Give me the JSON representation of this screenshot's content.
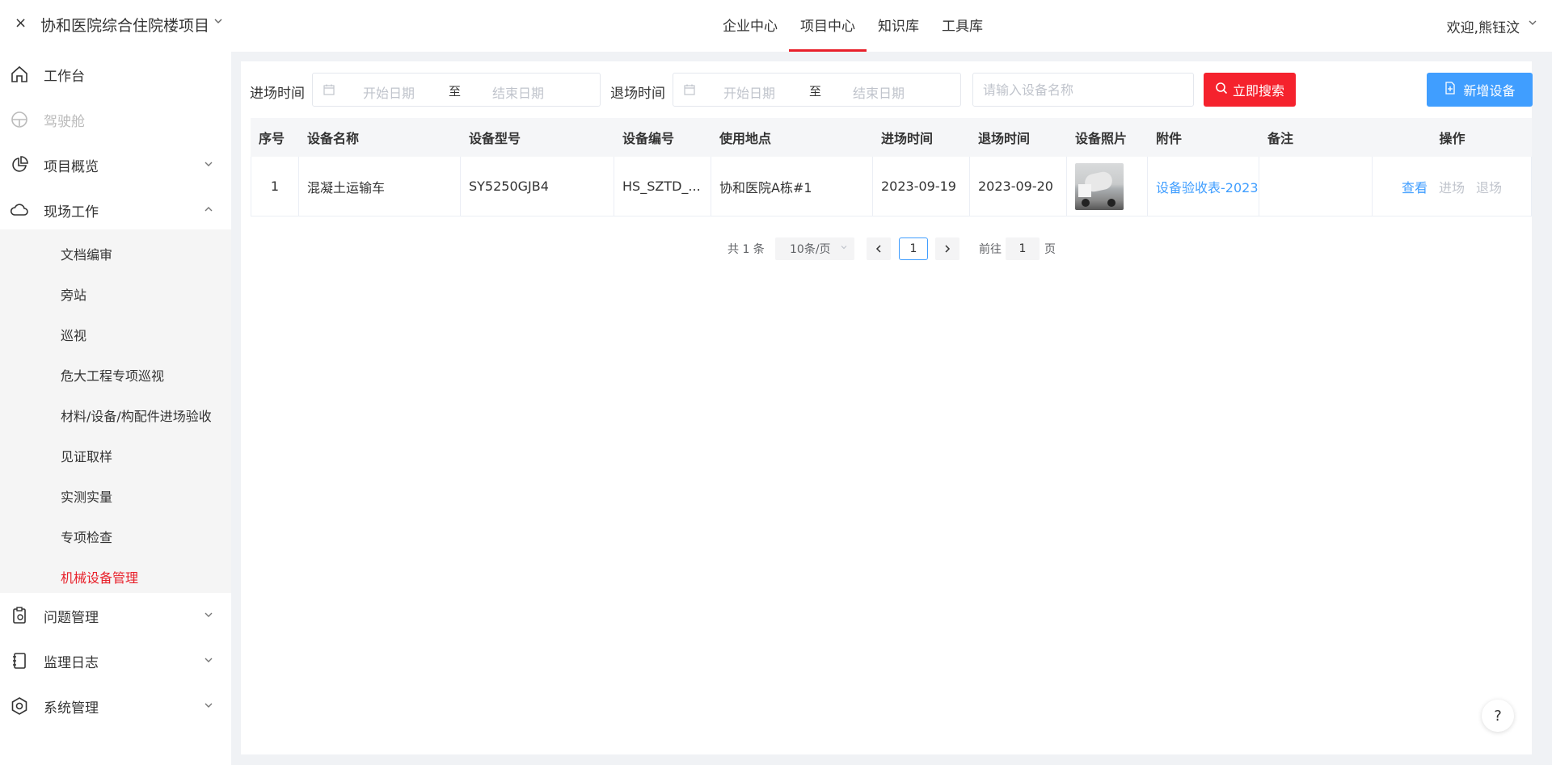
{
  "project": {
    "close": "×",
    "title": "协和医院综合住院楼项目",
    "chevron": "⌵"
  },
  "nav": [
    {
      "label": "企业中心",
      "active": false
    },
    {
      "label": "项目中心",
      "active": true
    },
    {
      "label": "知识库",
      "active": false
    },
    {
      "label": "工具库",
      "active": false
    }
  ],
  "user": {
    "welcome": "欢迎,熊钰汶"
  },
  "sidebar": {
    "items": [
      {
        "label": "工作台",
        "icon": "home-icon"
      },
      {
        "label": "驾驶舱",
        "icon": "dashboard-icon",
        "disabled": true
      },
      {
        "label": "项目概览",
        "icon": "pie-chart-icon"
      },
      {
        "label": "现场工作",
        "icon": "cloud-icon",
        "expanded": true
      },
      {
        "label": "问题管理",
        "icon": "clipboard-icon"
      },
      {
        "label": "监理日志",
        "icon": "notebook-icon"
      },
      {
        "label": "系统管理",
        "icon": "settings-icon"
      }
    ],
    "sub_items": [
      "文档编审",
      "旁站",
      "巡视",
      "危大工程专项巡视",
      "材料/设备/构配件进场验收",
      "见证取样",
      "实测实量",
      "专项检查",
      "机械设备管理"
    ],
    "active_sub": "机械设备管理"
  },
  "filters": {
    "entry_label": "进场时间",
    "exit_label": "退场时间",
    "start_placeholder": "开始日期",
    "end_placeholder": "结束日期",
    "range_sep": "至",
    "device_placeholder": "请输入设备名称",
    "search_button": "立即搜索",
    "add_button": "新增设备"
  },
  "table": {
    "headers": [
      "序号",
      "设备名称",
      "设备型号",
      "设备编号",
      "使用地点",
      "进场时间",
      "退场时间",
      "设备照片",
      "附件",
      "备注",
      "操作"
    ],
    "rows": [
      {
        "index": "1",
        "name": "混凝土运输车",
        "model": "SY5250GJB4",
        "code": "HS_SZTD_...",
        "location": "协和医院A栋#1",
        "entry_time": "2023-09-19",
        "exit_time": "2023-09-20",
        "photo": "concrete-mixer-truck",
        "attachment": "设备验收表-2023(",
        "remark": "",
        "actions": {
          "view": "查看",
          "enter": "进场",
          "exit": "退场"
        }
      }
    ]
  },
  "pagination": {
    "total": "共 1 条",
    "page_size": "10条/页",
    "current": "1",
    "goto_label": "前往",
    "goto_value": "1",
    "page_label": "页"
  },
  "help": "?",
  "colors": {
    "accent": "#e8202a",
    "primary": "#409eff",
    "search_red": "#f5222d"
  }
}
